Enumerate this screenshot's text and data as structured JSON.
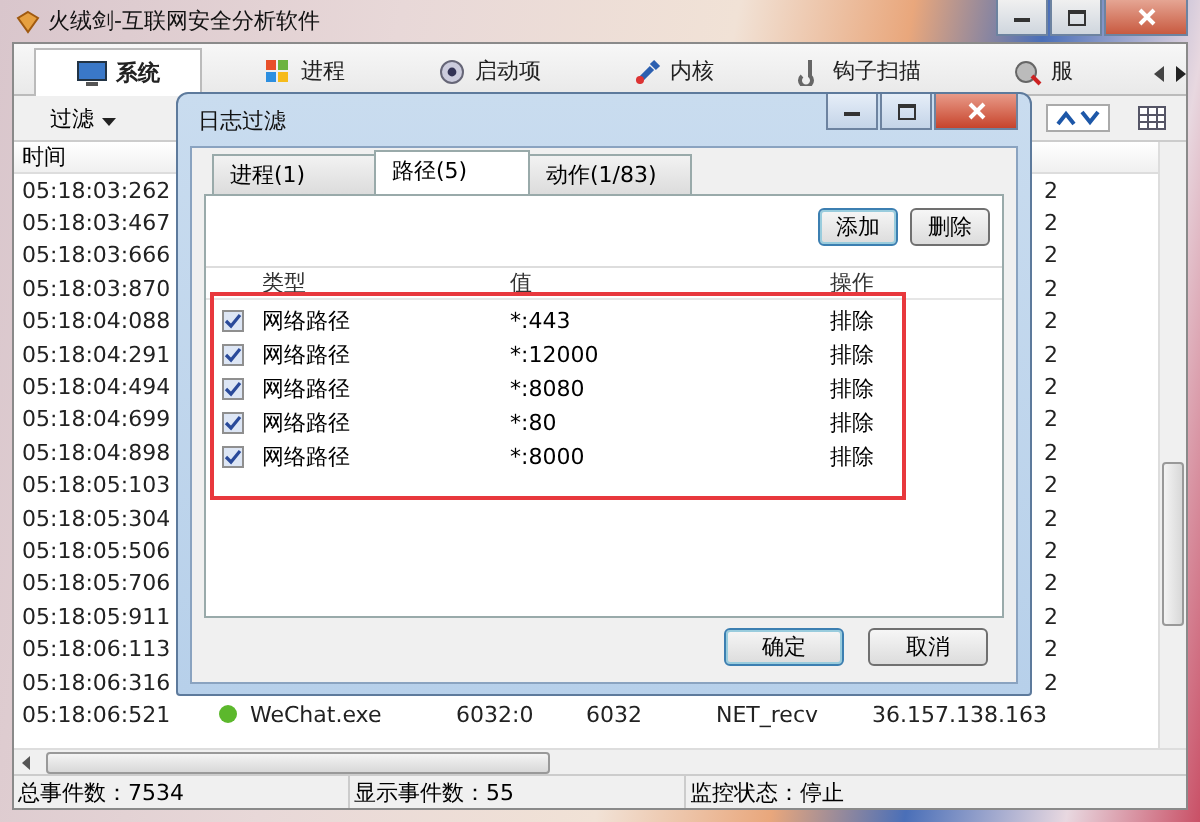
{
  "window": {
    "title": "火绒剑-互联网安全分析软件"
  },
  "tabs": [
    {
      "label": "系统",
      "selected": true
    },
    {
      "label": "进程",
      "selected": false
    },
    {
      "label": "启动项",
      "selected": false
    },
    {
      "label": "内核",
      "selected": false
    },
    {
      "label": "钩子扫描",
      "selected": false
    },
    {
      "label": "服",
      "selected": false
    }
  ],
  "toolbar": {
    "filter_label": "过滤"
  },
  "list": {
    "columns": [
      "时间"
    ],
    "rows": [
      {
        "time": "05:18:03:262",
        "column_end": "2"
      },
      {
        "time": "05:18:03:467",
        "column_end": "2"
      },
      {
        "time": "05:18:03:666",
        "column_end": "2"
      },
      {
        "time": "05:18:03:870",
        "column_end": "2"
      },
      {
        "time": "05:18:04:088",
        "column_end": "2"
      },
      {
        "time": "05:18:04:291",
        "column_end": "2"
      },
      {
        "time": "05:18:04:494",
        "column_end": "2"
      },
      {
        "time": "05:18:04:699",
        "column_end": "2"
      },
      {
        "time": "05:18:04:898",
        "column_end": "2"
      },
      {
        "time": "05:18:05:103",
        "column_end": "2"
      },
      {
        "time": "05:18:05:304",
        "column_end": "2"
      },
      {
        "time": "05:18:05:506",
        "column_end": "2"
      },
      {
        "time": "05:18:05:706",
        "column_end": "2"
      },
      {
        "time": "05:18:05:911",
        "column_end": "2"
      },
      {
        "time": "05:18:06:113",
        "column_end": "2"
      },
      {
        "time": "05:18:06:316",
        "column_end": "2"
      },
      {
        "time": "05:18:06:521",
        "process": "WeChat.exe",
        "column_3": "6032:0",
        "column_4": "6032",
        "column_5": "NET_recv",
        "column_6": "36.157.138.163"
      }
    ]
  },
  "status_bar": [
    "总事件数：7534",
    "显示事件数：55",
    "监控状态：停止"
  ],
  "dialog": {
    "title": "日志过滤",
    "tabs": [
      {
        "label": "进程(1)",
        "selected": false
      },
      {
        "label": "路径(5)",
        "selected": true
      },
      {
        "label": "动作(1/83)",
        "selected": false
      }
    ],
    "buttons": [
      "添加",
      "删除"
    ],
    "columns": [
      "类型",
      "值",
      "操作"
    ],
    "rules": [
      {
        "checked": true,
        "type": "网络路径",
        "value": "*:443",
        "action": "排除"
      },
      {
        "checked": true,
        "type": "网络路径",
        "value": "*:12000",
        "action": "排除"
      },
      {
        "checked": true,
        "type": "网络路径",
        "value": "*:8080",
        "action": "排除"
      },
      {
        "checked": true,
        "type": "网络路径",
        "value": "*:80",
        "action": "排除"
      },
      {
        "checked": true,
        "type": "网络路径",
        "value": "*:8000",
        "action": "排除"
      }
    ],
    "footer_buttons": [
      "确定",
      "取消"
    ]
  }
}
